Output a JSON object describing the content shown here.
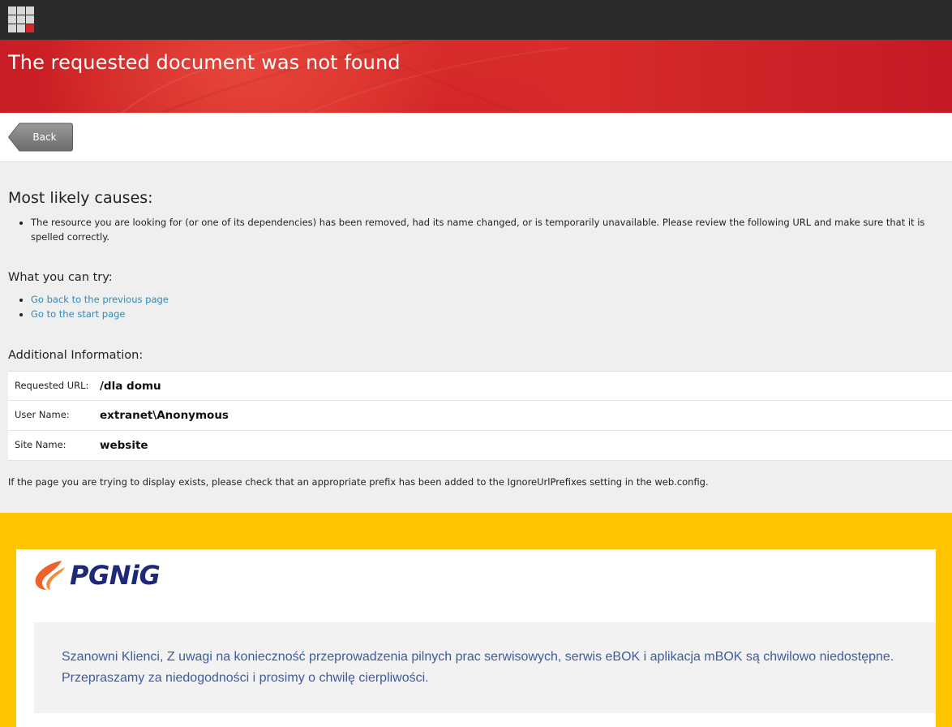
{
  "header": {
    "title": "The requested document was not found"
  },
  "toolbar": {
    "back_label": "Back"
  },
  "causes": {
    "title": "Most likely causes:",
    "items": [
      "The resource you are looking for (or one of its dependencies) has been removed, had its name changed, or is temporarily unavailable. Please review the following URL and make sure that it is spelled correctly."
    ]
  },
  "try": {
    "title": "What you can try:",
    "links": [
      "Go back to the previous page",
      "Go to the start page"
    ]
  },
  "additional": {
    "title": "Additional Information:",
    "rows": [
      {
        "key": "Requested URL:",
        "value": "/dla domu"
      },
      {
        "key": "User Name:",
        "value": "extranet\\Anonymous"
      },
      {
        "key": "Site Name:",
        "value": "website"
      }
    ]
  },
  "note": "If the page you are trying to display exists, please check that an appropriate prefix has been added to the IgnoreUrlPrefixes setting in the web.config.",
  "maintenance": {
    "logo_text": "PGNiG",
    "message": "Szanowni Klienci, Z uwagi na konieczność przeprowadzenia pilnych prac serwisowych, serwis eBOK i aplikacja mBOK są chwilowo niedostępne. Przepraszamy za niedogodności i prosimy o chwilę cierpliwości."
  },
  "colors": {
    "banner_red": "#d9262a",
    "topbar": "#2b2b2b",
    "link": "#2a8bbe",
    "yellow": "#ffc600",
    "brand_navy": "#1e2a78",
    "brand_orange": "#f0612a"
  }
}
